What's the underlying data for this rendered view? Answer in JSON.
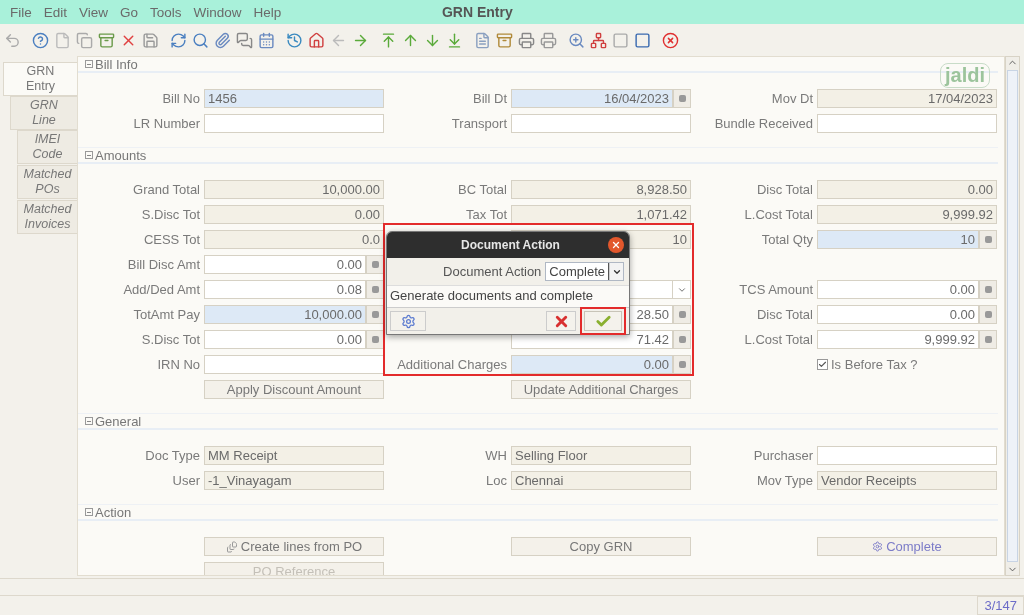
{
  "menu": [
    "File",
    "Edit",
    "View",
    "Go",
    "Tools",
    "Window",
    "Help"
  ],
  "window": {
    "title": "GRN Entry"
  },
  "logo": "jaldi",
  "tabs": [
    {
      "label": "GRN Entry",
      "selected": true,
      "children": [
        {
          "label": "GRN Line",
          "selected": false,
          "children": [
            {
              "label": "IMEI Code",
              "selected": false
            },
            {
              "label": "Matched POs",
              "selected": false
            },
            {
              "label": "Matched Invoices",
              "selected": false
            }
          ]
        }
      ]
    }
  ],
  "sections": [
    {
      "title": "Bill Info",
      "rows": [
        [
          {
            "kind": "field",
            "label": "Bill No",
            "value": "1456",
            "mandatory": true
          },
          {
            "kind": "field",
            "label": "Bill Dt",
            "value": "16/04/2023",
            "mandatory": true,
            "numeric": true,
            "button": true
          },
          {
            "kind": "field",
            "label": "Mov Dt",
            "value": "17/04/2023",
            "readonly": true,
            "numeric": true
          }
        ],
        [
          {
            "kind": "field",
            "label": "LR Number"
          },
          {
            "kind": "field",
            "label": "Transport"
          },
          {
            "kind": "field",
            "label": "Bundle Received"
          }
        ]
      ]
    },
    {
      "title": "Amounts",
      "rows": [
        [
          {
            "kind": "field",
            "label": "Grand Total",
            "value": "10,000.00",
            "readonly": true,
            "numeric": true
          },
          {
            "kind": "field",
            "label": "BC Total",
            "value": "8,928.50",
            "readonly": true,
            "numeric": true
          },
          {
            "kind": "field",
            "label": "Disc Total",
            "value": "0.00",
            "readonly": true,
            "numeric": true
          }
        ],
        [
          {
            "kind": "field",
            "label": "S.Disc Tot",
            "value": "0.00",
            "readonly": true,
            "numeric": true
          },
          {
            "kind": "field",
            "label": "Tax Tot",
            "value": "1,071.42",
            "readonly": true,
            "numeric": true
          },
          {
            "kind": "field",
            "label": "L.Cost Total",
            "value": "9,999.92",
            "readonly": true,
            "numeric": true
          }
        ],
        [
          {
            "kind": "field",
            "label": "CESS Tot",
            "value": "0.0",
            "readonly": true,
            "numeric": true
          },
          {
            "kind": "field",
            "value": "10",
            "readonly": true,
            "numeric": true
          },
          {
            "kind": "field",
            "label": "Total Qty",
            "value": "10",
            "mandatory": true,
            "numeric": true,
            "button": true
          }
        ],
        [
          {
            "kind": "field",
            "label": "Bill Disc Amt",
            "value": "0.00",
            "numeric": true,
            "button": true
          },
          {
            "kind": "empty"
          },
          {
            "kind": "empty"
          }
        ],
        [
          {
            "kind": "field",
            "label": "Add/Ded Amt",
            "value": "0.08",
            "numeric": true,
            "button": true
          },
          {
            "kind": "field",
            "dropdown": true
          },
          {
            "kind": "field",
            "label": "TCS Amount",
            "value": "0.00",
            "numeric": true,
            "button": true
          }
        ],
        [
          {
            "kind": "field",
            "label": "TotAmt Pay",
            "value": "10,000.00",
            "mandatory": true,
            "numeric": true,
            "button": true
          },
          {
            "kind": "field",
            "value": "28.50",
            "numeric": true,
            "button": true
          },
          {
            "kind": "field",
            "label": "Disc Total",
            "value": "0.00",
            "numeric": true,
            "button": true
          }
        ],
        [
          {
            "kind": "field",
            "label": "S.Disc Tot",
            "value": "0.00",
            "numeric": true,
            "button": true
          },
          {
            "kind": "field",
            "value": "71.42",
            "numeric": true,
            "button": true
          },
          {
            "kind": "field",
            "label": "L.Cost Total",
            "value": "9,999.92",
            "numeric": true,
            "button": true
          }
        ],
        [
          {
            "kind": "field",
            "label": "IRN No"
          },
          {
            "kind": "field",
            "label": "Additional Charges",
            "value": "0.00",
            "mandatory": true,
            "numeric": true,
            "button": true
          },
          {
            "kind": "checkbox",
            "label": "Is Before Tax ?",
            "checked": true
          }
        ],
        [
          {
            "kind": "button",
            "label": "Apply Discount Amount"
          },
          {
            "kind": "button",
            "label": "Update Additional Charges"
          },
          {
            "kind": "empty"
          }
        ]
      ]
    },
    {
      "title": "General",
      "rows": [
        [
          {
            "kind": "field",
            "label": "Doc Type",
            "value": "MM Receipt",
            "readonly": true
          },
          {
            "kind": "field",
            "label": "WH",
            "value": "Selling Floor",
            "readonly": true
          },
          {
            "kind": "field",
            "label": "Purchaser"
          }
        ],
        [
          {
            "kind": "field",
            "label": "User",
            "value": "-1_Vinayagam",
            "readonly": true
          },
          {
            "kind": "field",
            "label": "Loc",
            "value": "Chennai",
            "readonly": true
          },
          {
            "kind": "field",
            "label": "Mov Type",
            "value": "Vendor Receipts",
            "readonly": true
          }
        ]
      ]
    },
    {
      "title": "Action",
      "rows": [
        [
          {
            "kind": "doc_button",
            "label": "Create lines from PO"
          },
          {
            "kind": "button",
            "label": "Copy GRN"
          },
          {
            "kind": "process_button",
            "label": "Complete"
          }
        ],
        [
          {
            "kind": "button",
            "label": "PO Reference",
            "disabled": true
          },
          {
            "kind": "empty"
          },
          {
            "kind": "empty"
          }
        ]
      ]
    }
  ],
  "dialog": {
    "title": "Document Action",
    "field_label": "Document Action",
    "field_value": "Complete",
    "description": "Generate documents and complete",
    "highlighted": true,
    "buttons": [
      {
        "kind": "settings",
        "highlighted": false
      },
      {
        "kind": "cancel",
        "highlighted": false
      },
      {
        "kind": "ok",
        "highlighted": true
      }
    ]
  },
  "status_bar": {
    "record": "3/147"
  }
}
